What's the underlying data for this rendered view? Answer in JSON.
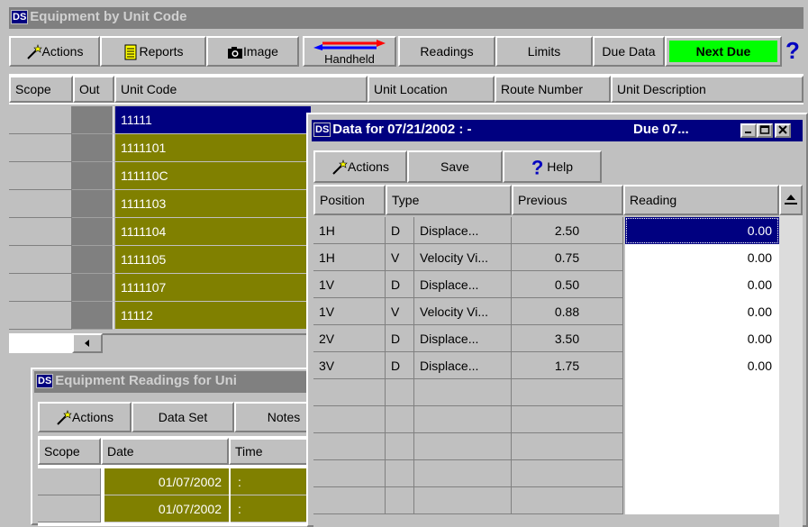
{
  "main": {
    "title": "Equipment by Unit Code",
    "toolbar": {
      "actions": "Actions",
      "reports": "Reports",
      "image": "Image",
      "handheld": "Handheld",
      "readings": "Readings",
      "limits": "Limits",
      "due_data": "Due Data",
      "next_due": "Next Due",
      "help": "?"
    },
    "columns": [
      "Scope",
      "Out",
      "Unit Code",
      "Unit Location",
      "Route Number",
      "Unit Description"
    ],
    "unit_codes": [
      "11111",
      "1111101",
      "111110C",
      "1111103",
      "1111104",
      "1111105",
      "1111107",
      "11112"
    ],
    "colors": {
      "olive": "#808000",
      "selected": "#000080",
      "next_due_bg": "#00ff00"
    }
  },
  "readings_window": {
    "title": "Equipment Readings for Uni",
    "toolbar": {
      "actions": "Actions",
      "data_set": "Data Set",
      "notes": "Notes"
    },
    "columns": [
      "Scope",
      "Date",
      "Time"
    ],
    "rows": [
      {
        "date": "01/07/2002",
        "time": ":"
      },
      {
        "date": "01/07/2002",
        "time": ":"
      }
    ]
  },
  "data_window": {
    "title": "Data for 07/21/2002   :  -",
    "title_right": "Due 07...",
    "toolbar": {
      "actions": "Actions",
      "save": "Save",
      "help_icon": "?",
      "help": "Help"
    },
    "columns": [
      "Position",
      "Type",
      "Previous",
      "Reading"
    ],
    "rows": [
      {
        "position": "1H",
        "type_code": "D",
        "type": "Displace...",
        "previous": "2.50",
        "reading": "0.00"
      },
      {
        "position": "1H",
        "type_code": "V",
        "type": "Velocity Vi...",
        "previous": "0.75",
        "reading": "0.00"
      },
      {
        "position": "1V",
        "type_code": "D",
        "type": "Displace...",
        "previous": "0.50",
        "reading": "0.00"
      },
      {
        "position": "1V",
        "type_code": "V",
        "type": "Velocity Vi...",
        "previous": "0.88",
        "reading": "0.00"
      },
      {
        "position": "2V",
        "type_code": "D",
        "type": "Displace...",
        "previous": "3.50",
        "reading": "0.00"
      },
      {
        "position": "3V",
        "type_code": "D",
        "type": "Displace...",
        "previous": "1.75",
        "reading": "0.00"
      }
    ]
  }
}
